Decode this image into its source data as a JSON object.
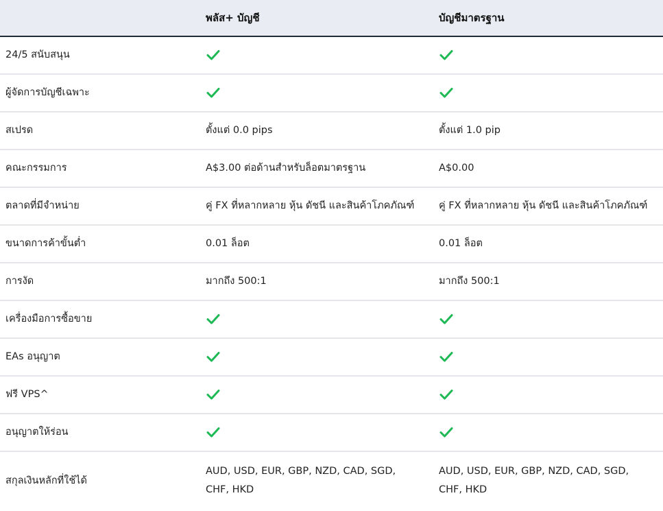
{
  "header": {
    "col1": "",
    "col2": "พลัส+ บัญชี",
    "col3": "บัญชีมาตรฐาน"
  },
  "rows": [
    {
      "label": "24/5 สนับสนุน",
      "plus": "check",
      "standard": "check"
    },
    {
      "label": "ผู้จัดการบัญชีเฉพาะ",
      "plus": "check",
      "standard": "check"
    },
    {
      "label": "สเปรด",
      "plus": "ตั้งแต่ 0.0 pips",
      "standard": "ตั้งแต่ 1.0 pip"
    },
    {
      "label": "คณะกรรมการ",
      "plus": "A$3.00 ต่อด้านสำหรับล็อตมาตรฐาน",
      "standard": "A$0.00"
    },
    {
      "label": "ตลาดที่มีจำหน่าย",
      "plus": "คู่ FX ที่หลากหลาย หุ้น ดัชนี และสินค้าโภคภัณฑ์",
      "standard": "คู่ FX ที่หลากหลาย หุ้น ดัชนี และสินค้าโภคภัณฑ์"
    },
    {
      "label": "ขนาดการค้าขั้นต่ำ",
      "plus": "0.01 ล็อต",
      "standard": "0.01 ล็อต"
    },
    {
      "label": "การงัด",
      "plus": "มากถึง 500:1",
      "standard": "มากถึง 500:1"
    },
    {
      "label": "เครื่องมือการซื้อขาย",
      "plus": "check",
      "standard": "check"
    },
    {
      "label": "EAs อนุญาต",
      "plus": "check",
      "standard": "check"
    },
    {
      "label": "ฟรี VPS^",
      "plus": "check",
      "standard": "check"
    },
    {
      "label": "อนุญาตให้ร่อน",
      "plus": "check",
      "standard": "check"
    },
    {
      "label": "สกุลเงินหลักที่ใช้ได้",
      "plus": "AUD, USD, EUR, GBP, NZD, CAD, SGD, CHF, HKD",
      "standard": "AUD, USD, EUR, GBP, NZD, CAD, SGD, CHF, HKD"
    }
  ],
  "colors": {
    "check": "#1db954",
    "header_bg": "#e9ecf2",
    "header_border": "#1c2b36",
    "row_border": "#e4e6ea"
  }
}
